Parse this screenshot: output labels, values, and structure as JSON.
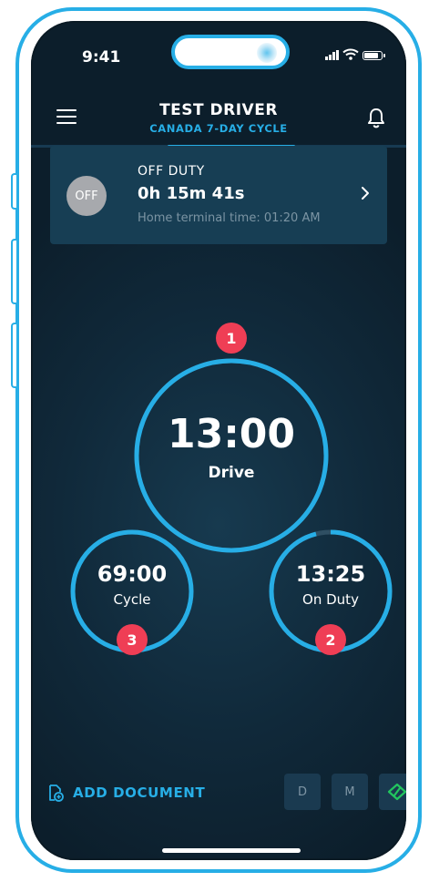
{
  "status_bar": {
    "time": "9:41"
  },
  "header": {
    "title": "TEST DRIVER",
    "subtitle": "CANADA 7-DAY CYCLE"
  },
  "status_card": {
    "off_badge": "OFF",
    "label": "OFF DUTY",
    "timer": "0h 15m 41s",
    "home_terminal": "Home terminal time: 01:20 AM"
  },
  "gauges": {
    "drive": {
      "value": "13:00",
      "label": "Drive",
      "badge": "1",
      "fraction": 1.0
    },
    "cycle": {
      "value": "69:00",
      "label": "Cycle",
      "badge": "3",
      "fraction": 1.0
    },
    "on_duty": {
      "value": "13:25",
      "label": "On Duty",
      "badge": "2",
      "fraction": 0.96
    }
  },
  "footer": {
    "add_document": "ADD DOCUMENT",
    "btn_d": "D",
    "btn_m": "M"
  },
  "colors": {
    "accent": "#27aee6",
    "badge": "#ef3e55",
    "card": "#173e54",
    "connected": "#22c55e"
  }
}
